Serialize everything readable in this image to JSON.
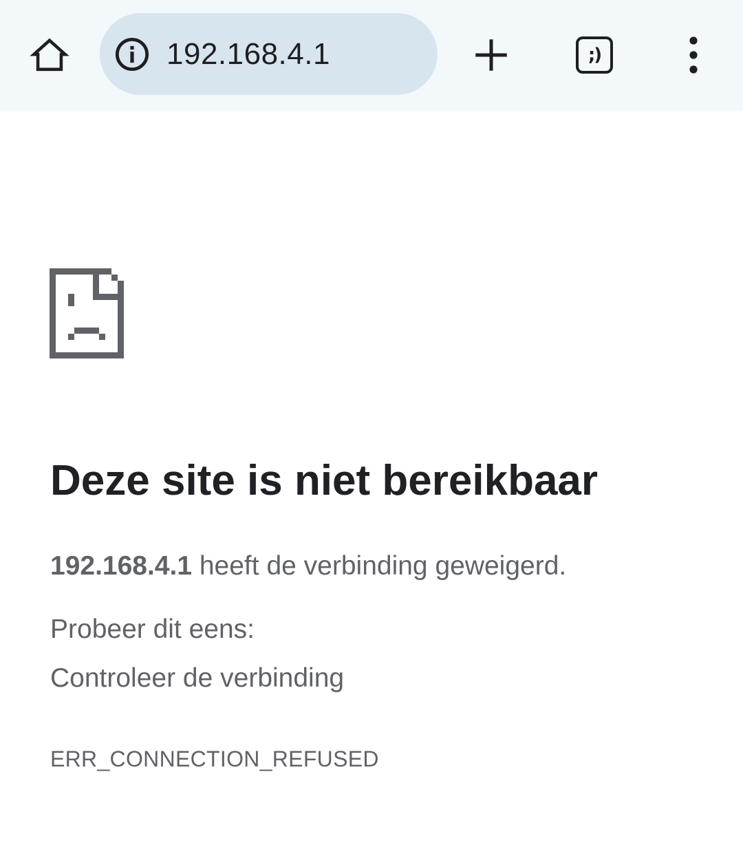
{
  "toolbar": {
    "icons": {
      "home": "home-icon",
      "site_info": "info-icon",
      "new_tab": "plus-icon",
      "tab_switcher": "tab-switcher-icon",
      "menu": "more-vertical-icon"
    },
    "address": "192.168.4.1",
    "tab_switcher_label": ";)"
  },
  "error": {
    "icon": "sad-document-icon",
    "title": "Deze site is niet bereikbaar",
    "host": "192.168.4.1",
    "detail_suffix": " heeft de verbinding geweigerd.",
    "try_heading": "Probeer dit eens:",
    "suggestion": "Controleer de verbinding",
    "code": "ERR_CONNECTION_REFUSED"
  },
  "colors": {
    "toolbar_bg": "#f3f8fb",
    "omnibox_bg": "#d7e6ee",
    "title": "#202124",
    "body_text": "#5f6368",
    "icon": "#1f1f1f",
    "error_icon": "#5f6368"
  }
}
